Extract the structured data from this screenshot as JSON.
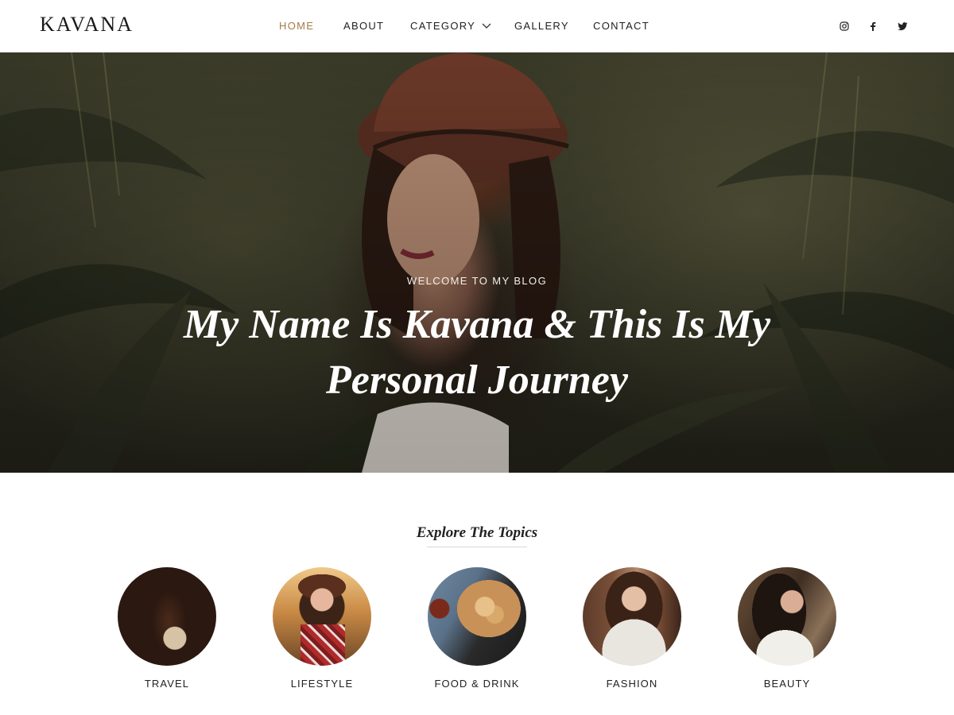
{
  "header": {
    "logo": "KAVANA",
    "nav": [
      {
        "label": "HOME",
        "active": true
      },
      {
        "label": "ABOUT"
      },
      {
        "label": "CATEGORY",
        "has_dropdown": true
      },
      {
        "label": "GALLERY"
      },
      {
        "label": "CONTACT"
      }
    ],
    "social": [
      {
        "icon": "instagram-icon"
      },
      {
        "icon": "facebook-icon"
      },
      {
        "icon": "twitter-icon"
      }
    ]
  },
  "hero": {
    "kicker": "WELCOME TO MY BLOG",
    "title": "My Name Is Kavana & This Is My Personal Journey"
  },
  "topics": {
    "heading": "Explore The Topics",
    "items": [
      {
        "label": "TRAVEL"
      },
      {
        "label": "LIFESTYLE"
      },
      {
        "label": "FOOD & DRINK"
      },
      {
        "label": "FASHION"
      },
      {
        "label": "BEAUTY"
      }
    ]
  },
  "colors": {
    "accent": "#a57b46",
    "text": "#222222",
    "background": "#ffffff"
  }
}
